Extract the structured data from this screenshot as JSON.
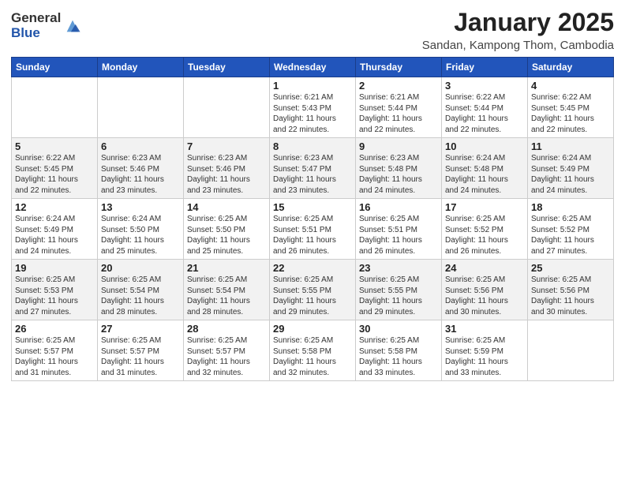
{
  "logo": {
    "general": "General",
    "blue": "Blue"
  },
  "title": "January 2025",
  "location": "Sandan, Kampong Thom, Cambodia",
  "weekdays": [
    "Sunday",
    "Monday",
    "Tuesday",
    "Wednesday",
    "Thursday",
    "Friday",
    "Saturday"
  ],
  "weeks": [
    [
      {
        "day": "",
        "info": ""
      },
      {
        "day": "",
        "info": ""
      },
      {
        "day": "",
        "info": ""
      },
      {
        "day": "1",
        "info": "Sunrise: 6:21 AM\nSunset: 5:43 PM\nDaylight: 11 hours\nand 22 minutes."
      },
      {
        "day": "2",
        "info": "Sunrise: 6:21 AM\nSunset: 5:44 PM\nDaylight: 11 hours\nand 22 minutes."
      },
      {
        "day": "3",
        "info": "Sunrise: 6:22 AM\nSunset: 5:44 PM\nDaylight: 11 hours\nand 22 minutes."
      },
      {
        "day": "4",
        "info": "Sunrise: 6:22 AM\nSunset: 5:45 PM\nDaylight: 11 hours\nand 22 minutes."
      }
    ],
    [
      {
        "day": "5",
        "info": "Sunrise: 6:22 AM\nSunset: 5:45 PM\nDaylight: 11 hours\nand 22 minutes."
      },
      {
        "day": "6",
        "info": "Sunrise: 6:23 AM\nSunset: 5:46 PM\nDaylight: 11 hours\nand 23 minutes."
      },
      {
        "day": "7",
        "info": "Sunrise: 6:23 AM\nSunset: 5:46 PM\nDaylight: 11 hours\nand 23 minutes."
      },
      {
        "day": "8",
        "info": "Sunrise: 6:23 AM\nSunset: 5:47 PM\nDaylight: 11 hours\nand 23 minutes."
      },
      {
        "day": "9",
        "info": "Sunrise: 6:23 AM\nSunset: 5:48 PM\nDaylight: 11 hours\nand 24 minutes."
      },
      {
        "day": "10",
        "info": "Sunrise: 6:24 AM\nSunset: 5:48 PM\nDaylight: 11 hours\nand 24 minutes."
      },
      {
        "day": "11",
        "info": "Sunrise: 6:24 AM\nSunset: 5:49 PM\nDaylight: 11 hours\nand 24 minutes."
      }
    ],
    [
      {
        "day": "12",
        "info": "Sunrise: 6:24 AM\nSunset: 5:49 PM\nDaylight: 11 hours\nand 24 minutes."
      },
      {
        "day": "13",
        "info": "Sunrise: 6:24 AM\nSunset: 5:50 PM\nDaylight: 11 hours\nand 25 minutes."
      },
      {
        "day": "14",
        "info": "Sunrise: 6:25 AM\nSunset: 5:50 PM\nDaylight: 11 hours\nand 25 minutes."
      },
      {
        "day": "15",
        "info": "Sunrise: 6:25 AM\nSunset: 5:51 PM\nDaylight: 11 hours\nand 26 minutes."
      },
      {
        "day": "16",
        "info": "Sunrise: 6:25 AM\nSunset: 5:51 PM\nDaylight: 11 hours\nand 26 minutes."
      },
      {
        "day": "17",
        "info": "Sunrise: 6:25 AM\nSunset: 5:52 PM\nDaylight: 11 hours\nand 26 minutes."
      },
      {
        "day": "18",
        "info": "Sunrise: 6:25 AM\nSunset: 5:52 PM\nDaylight: 11 hours\nand 27 minutes."
      }
    ],
    [
      {
        "day": "19",
        "info": "Sunrise: 6:25 AM\nSunset: 5:53 PM\nDaylight: 11 hours\nand 27 minutes."
      },
      {
        "day": "20",
        "info": "Sunrise: 6:25 AM\nSunset: 5:54 PM\nDaylight: 11 hours\nand 28 minutes."
      },
      {
        "day": "21",
        "info": "Sunrise: 6:25 AM\nSunset: 5:54 PM\nDaylight: 11 hours\nand 28 minutes."
      },
      {
        "day": "22",
        "info": "Sunrise: 6:25 AM\nSunset: 5:55 PM\nDaylight: 11 hours\nand 29 minutes."
      },
      {
        "day": "23",
        "info": "Sunrise: 6:25 AM\nSunset: 5:55 PM\nDaylight: 11 hours\nand 29 minutes."
      },
      {
        "day": "24",
        "info": "Sunrise: 6:25 AM\nSunset: 5:56 PM\nDaylight: 11 hours\nand 30 minutes."
      },
      {
        "day": "25",
        "info": "Sunrise: 6:25 AM\nSunset: 5:56 PM\nDaylight: 11 hours\nand 30 minutes."
      }
    ],
    [
      {
        "day": "26",
        "info": "Sunrise: 6:25 AM\nSunset: 5:57 PM\nDaylight: 11 hours\nand 31 minutes."
      },
      {
        "day": "27",
        "info": "Sunrise: 6:25 AM\nSunset: 5:57 PM\nDaylight: 11 hours\nand 31 minutes."
      },
      {
        "day": "28",
        "info": "Sunrise: 6:25 AM\nSunset: 5:57 PM\nDaylight: 11 hours\nand 32 minutes."
      },
      {
        "day": "29",
        "info": "Sunrise: 6:25 AM\nSunset: 5:58 PM\nDaylight: 11 hours\nand 32 minutes."
      },
      {
        "day": "30",
        "info": "Sunrise: 6:25 AM\nSunset: 5:58 PM\nDaylight: 11 hours\nand 33 minutes."
      },
      {
        "day": "31",
        "info": "Sunrise: 6:25 AM\nSunset: 5:59 PM\nDaylight: 11 hours\nand 33 minutes."
      },
      {
        "day": "",
        "info": ""
      }
    ]
  ]
}
